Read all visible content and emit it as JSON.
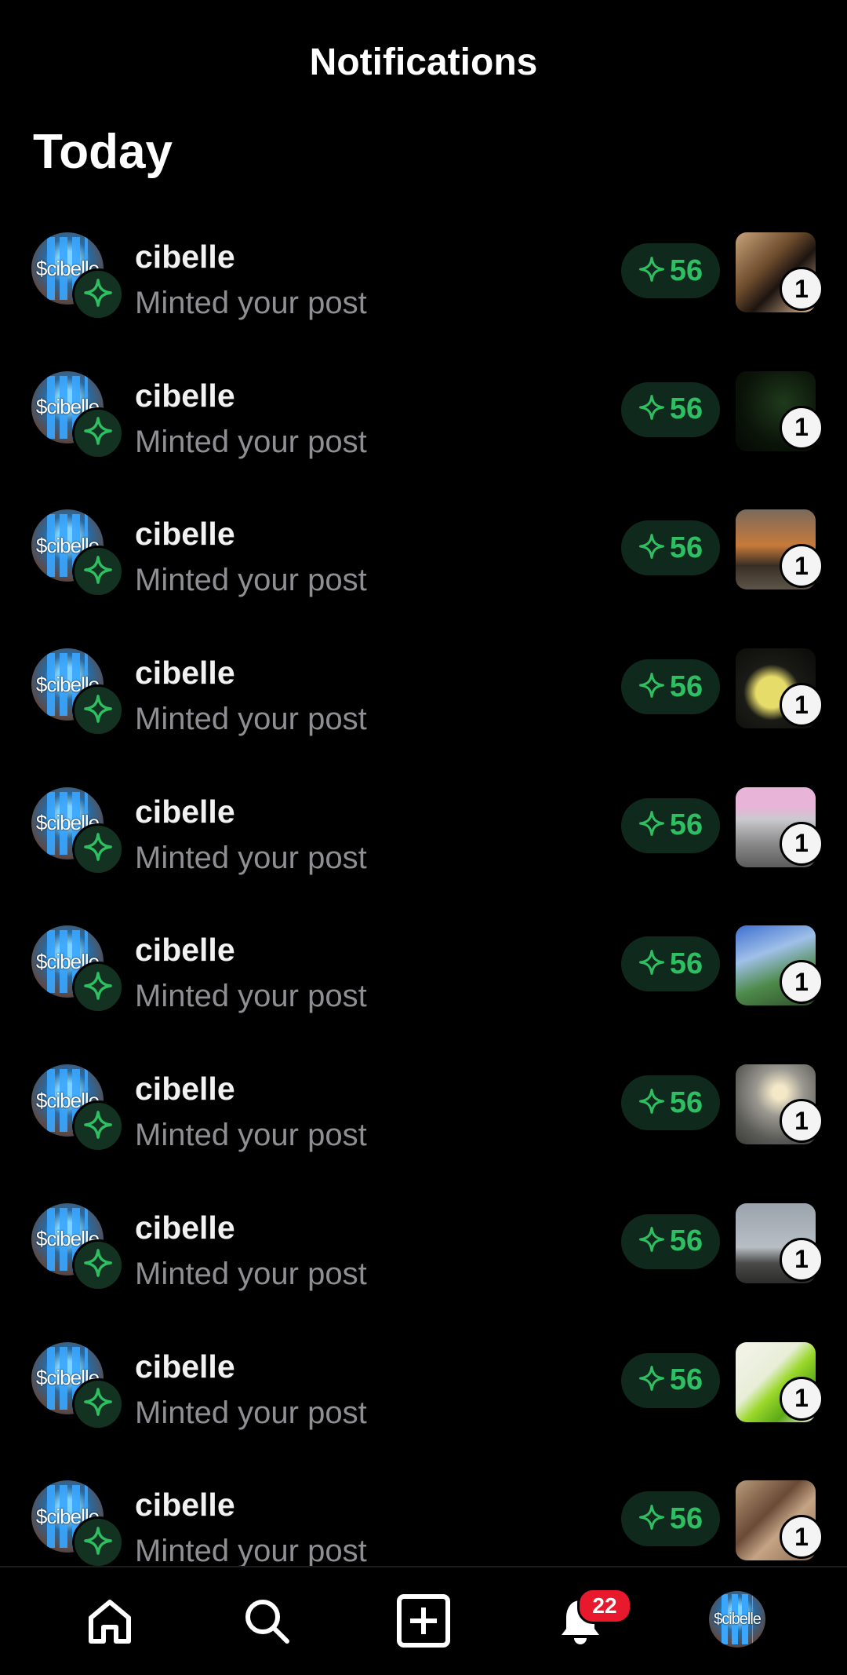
{
  "header": {
    "title": "Notifications"
  },
  "section": {
    "title": "Today"
  },
  "notifications": [
    {
      "username": "cibelle",
      "action": "Minted your post",
      "mint_count": "56",
      "post_count": "1",
      "avatar_text": "$cibelle"
    },
    {
      "username": "cibelle",
      "action": "Minted your post",
      "mint_count": "56",
      "post_count": "1",
      "avatar_text": "$cibelle"
    },
    {
      "username": "cibelle",
      "action": "Minted your post",
      "mint_count": "56",
      "post_count": "1",
      "avatar_text": "$cibelle"
    },
    {
      "username": "cibelle",
      "action": "Minted your post",
      "mint_count": "56",
      "post_count": "1",
      "avatar_text": "$cibelle"
    },
    {
      "username": "cibelle",
      "action": "Minted your post",
      "mint_count": "56",
      "post_count": "1",
      "avatar_text": "$cibelle"
    },
    {
      "username": "cibelle",
      "action": "Minted your post",
      "mint_count": "56",
      "post_count": "1",
      "avatar_text": "$cibelle"
    },
    {
      "username": "cibelle",
      "action": "Minted your post",
      "mint_count": "56",
      "post_count": "1",
      "avatar_text": "$cibelle"
    },
    {
      "username": "cibelle",
      "action": "Minted your post",
      "mint_count": "56",
      "post_count": "1",
      "avatar_text": "$cibelle"
    },
    {
      "username": "cibelle",
      "action": "Minted your post",
      "mint_count": "56",
      "post_count": "1",
      "avatar_text": "$cibelle"
    },
    {
      "username": "cibelle",
      "action": "Minted your post",
      "mint_count": "56",
      "post_count": "1",
      "avatar_text": "$cibelle"
    }
  ],
  "nav": {
    "items": [
      {
        "icon": "home-icon"
      },
      {
        "icon": "search-icon"
      },
      {
        "icon": "add-post-icon"
      },
      {
        "icon": "bell-icon"
      },
      {
        "icon": "profile-avatar"
      }
    ],
    "notification_badge": "22",
    "profile_text": "$cibelle"
  },
  "colors": {
    "background": "#000000",
    "mint_green": "#2fbf63",
    "badge_red": "#e8192c",
    "muted_text": "#8e8e93"
  }
}
